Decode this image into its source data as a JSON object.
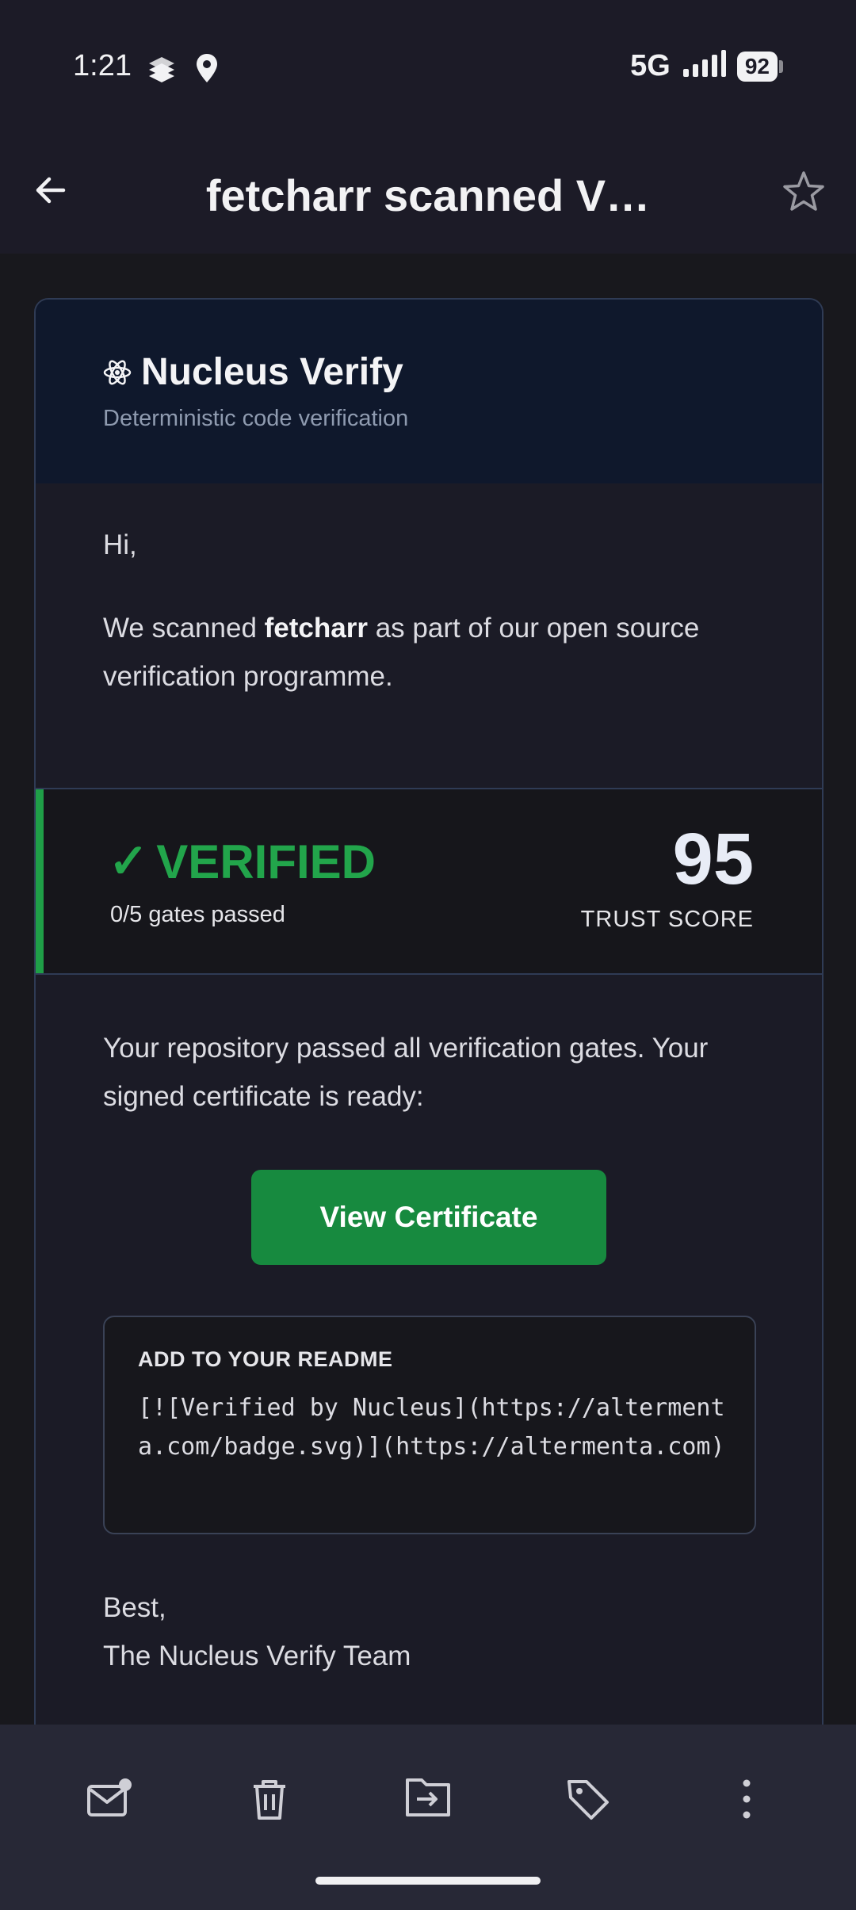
{
  "status_bar": {
    "time": "1:21",
    "network": "5G",
    "battery": "92"
  },
  "app_bar": {
    "title": "fetcharr scanned V…"
  },
  "email": {
    "brand": {
      "name": "Nucleus Verify",
      "tagline": "Deterministic code verification"
    },
    "greeting": "Hi,",
    "intro": {
      "prefix": "We scanned ",
      "repo": "fetcharr",
      "suffix": " as part of our open source verification programme."
    },
    "verification": {
      "check": "✓",
      "status": "VERIFIED",
      "gates": "0/5 gates passed",
      "trust_score": "95",
      "trust_score_label": "TRUST SCORE",
      "accent_color": "#22a54b"
    },
    "body": "Your repository passed all verification gates. Your signed certificate is ready:",
    "cta_label": "View Certificate",
    "readme": {
      "title": "ADD TO YOUR README",
      "code": "[![Verified by Nucleus](https://altermenta.com/badge.svg)](https://altermenta.com)"
    },
    "signoff": {
      "line1": "Best,",
      "line2": "The Nucleus Verify Team"
    }
  },
  "bottom_bar": {
    "actions": [
      "mark-unread-icon",
      "trash-icon",
      "move-to-icon",
      "label-icon",
      "more-vert-icon"
    ]
  }
}
